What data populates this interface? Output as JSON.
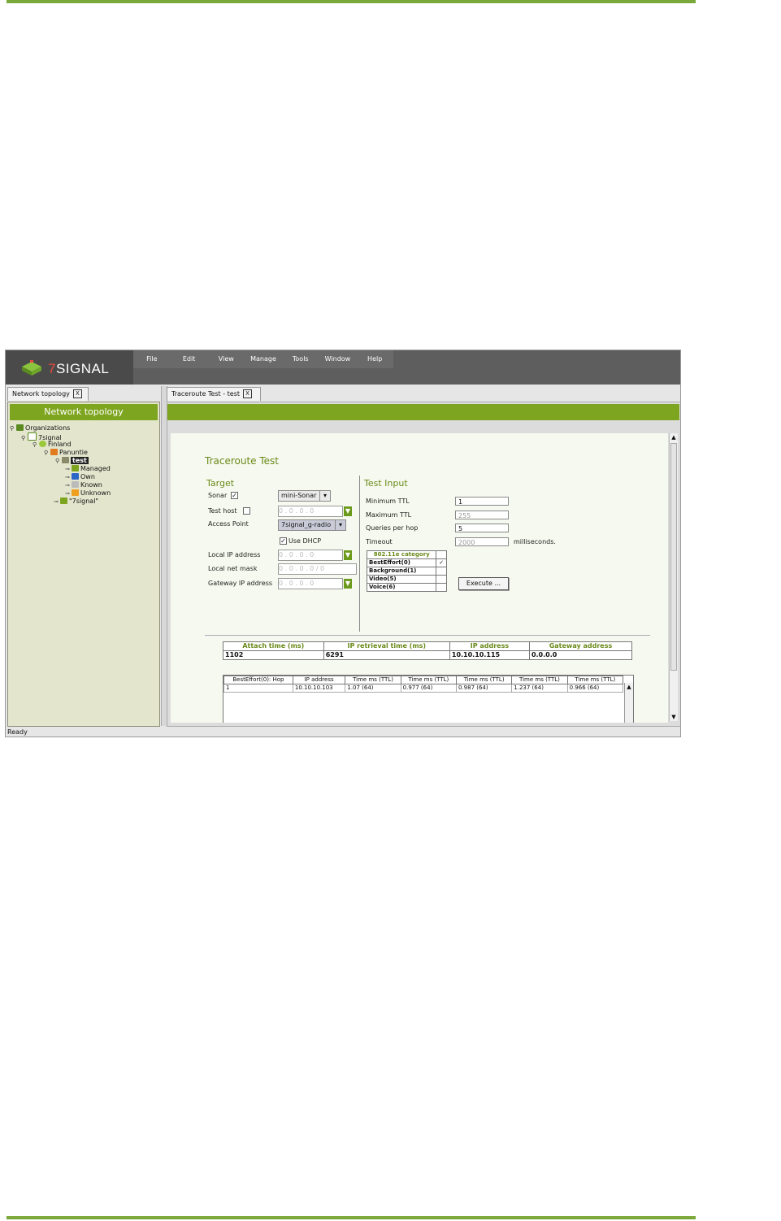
{
  "app": {
    "logo_text": "SIGNAL",
    "logo_seven": "7",
    "menu": [
      "File",
      "Edit",
      "View",
      "Manage",
      "Tools",
      "Window",
      "Help"
    ],
    "left_tab": "Network topology",
    "right_tab": "Traceroute Test - test",
    "tab_close": "X",
    "status": "Ready"
  },
  "tree": {
    "header": "Network topology",
    "nodes": [
      "Organizations",
      "7signal",
      "Finland",
      "Panuntie",
      "test",
      "Managed",
      "Own",
      "Known",
      "Unknown",
      "\"7signal\""
    ]
  },
  "form": {
    "title": "Traceroute Test",
    "target_heading": "Target",
    "sonar_label": "Sonar",
    "sonar_checked": "✓",
    "sonar_value": "mini-Sonar",
    "test_host_label": "Test host",
    "access_point_label": "Access Point",
    "access_point_value": "7signal_g-radio",
    "use_dhcp_label": "Use DHCP",
    "use_dhcp_checked": "✓",
    "local_ip_label": "Local IP address",
    "local_mask_label": "Local net mask",
    "gateway_ip_label": "Gateway IP address",
    "ip_placeholder": "0 . 0 . 0 . 0",
    "mask_placeholder": "0 . 0 . 0 . 0 / 0",
    "dropdown_arrow": "▼",
    "test_input_heading": "Test Input",
    "min_ttl_label": "Minimum TTL",
    "min_ttl_value": "1",
    "max_ttl_label": "Maximum TTL",
    "max_ttl_value": "255",
    "queries_label": "Queries per hop",
    "queries_value": "5",
    "timeout_label": "Timeout",
    "timeout_value": "2000",
    "timeout_unit": "milliseconds.",
    "category_header": "802.11e category",
    "categories": [
      {
        "label": "BestEffort(0)",
        "checked": "✓"
      },
      {
        "label": "Background(1)",
        "checked": ""
      },
      {
        "label": "Video(5)",
        "checked": ""
      },
      {
        "label": "Voice(6)",
        "checked": ""
      }
    ],
    "execute_label": "Execute ..."
  },
  "info_table": {
    "headers": [
      "Attach time (ms)",
      "IP retrieval time (ms)",
      "IP address",
      "Gateway address"
    ],
    "row": [
      "1102",
      "6291",
      "10.10.10.115",
      "0.0.0.0"
    ]
  },
  "results_table": {
    "headers": [
      "BestEffort(0): Hop",
      "IP address",
      "Time ms (TTL)",
      "Time ms (TTL)",
      "Time ms (TTL)",
      "Time ms (TTL)",
      "Time ms (TTL)"
    ],
    "rows": [
      [
        "1",
        "10.10.10.103",
        "1.07 (64)",
        "0.977 (64)",
        "0.987 (64)",
        "1.237 (64)",
        "0.966 (64)"
      ]
    ]
  }
}
